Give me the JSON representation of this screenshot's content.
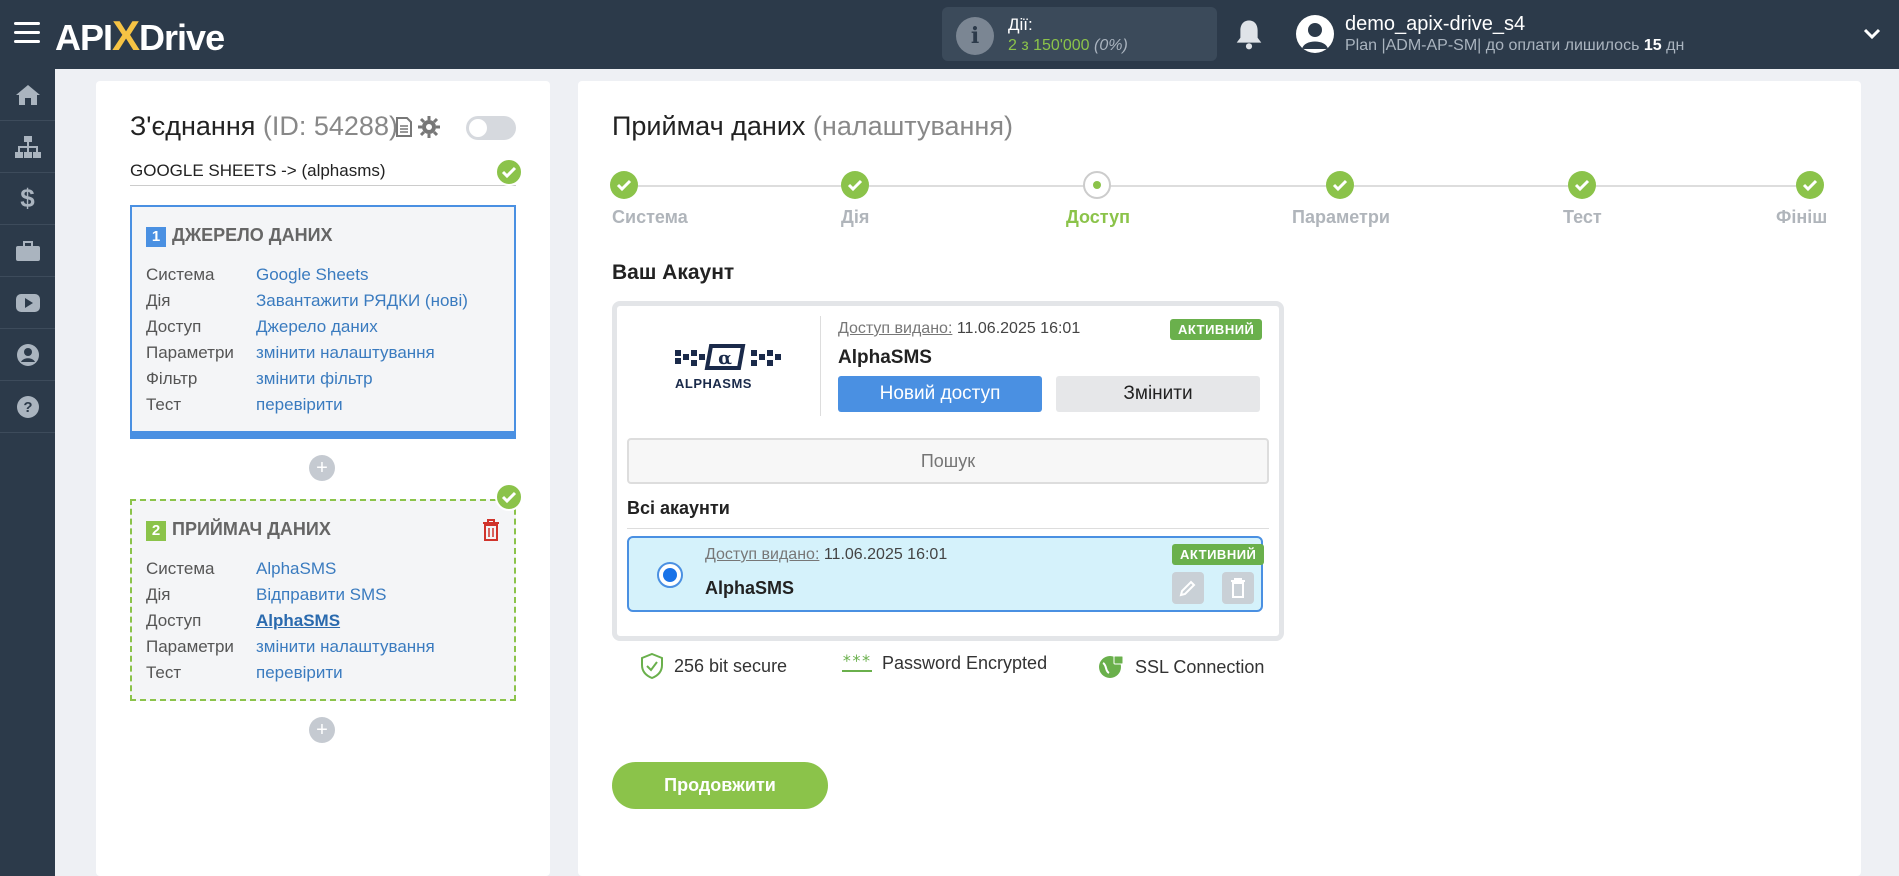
{
  "header": {
    "logo_api": "API",
    "logo_x": "X",
    "logo_drive": "Drive",
    "actions_label": "Дії:",
    "actions_value": "2 з 150'000",
    "actions_pct": "(0%)",
    "username": "demo_apix-drive_s4",
    "plan_prefix": "Plan |ADM-AP-SM| до оплати лишилось ",
    "plan_days": "15",
    "plan_suffix": " дн"
  },
  "sidebar": {
    "items": [
      "home-icon",
      "sitemap-icon",
      "dollar-icon",
      "briefcase-icon",
      "youtube-icon",
      "user-icon",
      "help-icon"
    ]
  },
  "connection": {
    "title": "З'єднання",
    "id_text": "(ID: 54288)",
    "name": "GOOGLE SHEETS -> (alphasms)"
  },
  "source": {
    "num": "1",
    "header": "ДЖЕРЕЛО ДАНИХ",
    "rows": [
      {
        "k": "Система",
        "v": "Google Sheets"
      },
      {
        "k": "Дія",
        "v": "Завантажити РЯДКИ (нові)"
      },
      {
        "k": "Доступ",
        "v": "Джерело даних"
      },
      {
        "k": "Параметри",
        "v": "змінити налаштування"
      },
      {
        "k": "Фільтр",
        "v": "змінити фільтр"
      },
      {
        "k": "Тест",
        "v": "перевірити"
      }
    ]
  },
  "destination": {
    "num": "2",
    "header": "ПРИЙМАЧ ДАНИХ",
    "rows": [
      {
        "k": "Система",
        "v": "AlphaSMS"
      },
      {
        "k": "Дія",
        "v": "Відправити SMS"
      },
      {
        "k": "Доступ",
        "v": "AlphaSMS"
      },
      {
        "k": "Параметри",
        "v": "змінити налаштування"
      },
      {
        "k": "Тест",
        "v": "перевірити"
      }
    ]
  },
  "main": {
    "title": "Приймач даних",
    "subtitle": "(налаштування)",
    "steps": [
      "Система",
      "Дія",
      "Доступ",
      "Параметри",
      "Тест",
      "Фініш"
    ],
    "current_step": "Доступ",
    "account_title": "Ваш Акаунт",
    "logo_text": "ALPHASMS",
    "granted_label": "Доступ видано:",
    "granted_date": "11.06.2025 16:01",
    "active_badge": "АКТИВНИЙ",
    "account_name": "AlphaSMS",
    "new_access_btn": "Новий доступ",
    "change_btn": "Змінити",
    "search_placeholder": "Пошук",
    "all_accounts": "Всі акаунти",
    "item_granted_label": "Доступ видано:",
    "item_granted_date": "11.06.2025 16:01",
    "item_name": "AlphaSMS",
    "item_badge": "АКТИВНИЙ",
    "security": [
      "256 bit secure",
      "Password Encrypted",
      "SSL Connection"
    ],
    "continue_btn": "Продовжити"
  },
  "colors": {
    "topbar": "#2c3a4a",
    "accent_green": "#8bc34a",
    "accent_blue": "#4a90e2"
  }
}
